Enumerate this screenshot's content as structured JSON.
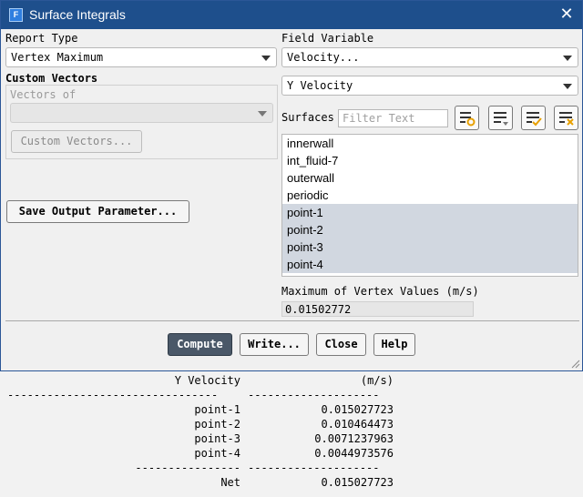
{
  "window": {
    "title": "Surface Integrals",
    "app_icon_letter": "F"
  },
  "report_type": {
    "label": "Report Type",
    "value": "Vertex Maximum"
  },
  "custom_vectors": {
    "heading": "Custom Vectors",
    "vectors_of_label": "Vectors of",
    "vectors_of_value": "",
    "button_label": "Custom Vectors..."
  },
  "save_output_button": "Save Output Parameter...",
  "field_variable": {
    "label": "Field Variable",
    "value": "Velocity...",
    "sub_value": "Y Velocity"
  },
  "surfaces": {
    "label": "Surfaces",
    "filter_placeholder": "Filter Text",
    "items": [
      {
        "name": "innerwall",
        "selected": false
      },
      {
        "name": "int_fluid-7",
        "selected": false
      },
      {
        "name": "outerwall",
        "selected": false
      },
      {
        "name": "periodic",
        "selected": false
      },
      {
        "name": "point-1",
        "selected": true
      },
      {
        "name": "point-2",
        "selected": true
      },
      {
        "name": "point-3",
        "selected": true
      },
      {
        "name": "point-4",
        "selected": true
      }
    ]
  },
  "result": {
    "label": "Maximum of Vertex Values (m/s)",
    "value": "0.01502772"
  },
  "buttons": {
    "compute": "Compute",
    "write": "Write...",
    "close": "Close",
    "help": "Help"
  },
  "console": {
    "header_left": "Y Velocity",
    "header_right": "(m/s)",
    "sep_left_long": "--------------------------------",
    "sep_right": "--------------------",
    "sep_left_short": "----------------",
    "rows": [
      {
        "name": "point-1",
        "value": "0.015027723"
      },
      {
        "name": "point-2",
        "value": "0.010464473"
      },
      {
        "name": "point-3",
        "value": "0.0071237963"
      },
      {
        "name": "point-4",
        "value": "0.0044973576"
      }
    ],
    "net_label": "Net",
    "net_value": "0.015027723"
  }
}
